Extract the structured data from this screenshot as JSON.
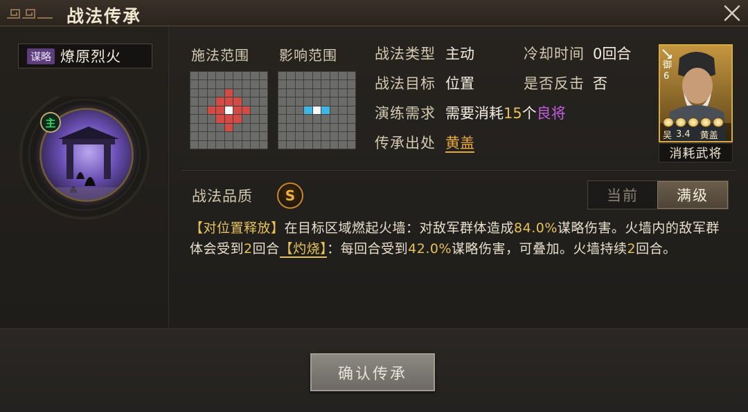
{
  "window": {
    "title": "战法传承"
  },
  "skill": {
    "type_tag": "谋略",
    "name": "燎原烈火",
    "role_badge": "主"
  },
  "range": {
    "cast_label": "施法范围",
    "effect_label": "影响范围",
    "cast_grid": [
      "000000000",
      "000000000",
      "000010000",
      "000111000",
      "001121100",
      "000111000",
      "000010000",
      "000000000",
      "000000000"
    ],
    "effect_grid": [
      "000000000",
      "000000000",
      "000000000",
      "000000000",
      "000323000",
      "000000000",
      "000000000",
      "000000000",
      "000000000"
    ]
  },
  "info": {
    "type_key": "战法类型",
    "type_val": "主动",
    "cooldown_key": "冷却时间",
    "cooldown_val": "0回合",
    "target_key": "战法目标",
    "target_val": "位置",
    "counter_key": "是否反击",
    "counter_val": "否",
    "req_key": "演练需求",
    "req_prefix": "需要消耗",
    "req_count": "15",
    "req_unit": "个",
    "req_quality": "良将",
    "source_key": "传承出处",
    "source_val": "黄盖"
  },
  "general": {
    "troop": "御",
    "troop_count": "6",
    "stars": 5,
    "faction": "吴",
    "cost": "3.4",
    "name": "黄盖",
    "button_label": "消耗武将"
  },
  "quality": {
    "label": "战法品质",
    "grade": "S"
  },
  "toggle": {
    "current": "当前",
    "max": "满级",
    "selected": "满级"
  },
  "description": {
    "tag1": "【对位置释放】",
    "part1": "在目标区域燃起火墙：对敌军群体造成",
    "pct1": "84.0%",
    "part2": "谋略伤害。火墙内的敌军群体会受到",
    "turns1": "2",
    "part3": "回合",
    "tag2": "【灼烧】",
    "part4": "：每回合受到",
    "pct2": "42.0%",
    "part5": "谋略伤害，可叠加。火墙持续",
    "turns2": "2",
    "part6": "回合。"
  },
  "actions": {
    "confirm": "确认传承"
  }
}
